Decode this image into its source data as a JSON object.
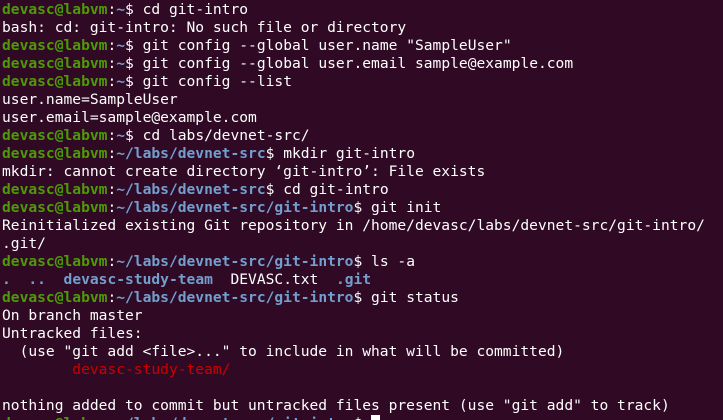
{
  "prompt": {
    "user_host": "devasc@labvm",
    "colon": ":",
    "dollar": "$ "
  },
  "lines": [
    {
      "path": "~",
      "cmd": "cd git-intro"
    },
    {
      "out": "bash: cd: git-intro: No such file or directory"
    },
    {
      "path": "~",
      "cmd": "git config --global user.name \"SampleUser\""
    },
    {
      "path": "~",
      "cmd": "git config --global user.email sample@example.com"
    },
    {
      "path": "~",
      "cmd": "git config --list"
    },
    {
      "out": "user.name=SampleUser"
    },
    {
      "out": "user.email=sample@example.com"
    },
    {
      "path": "~",
      "cmd": "cd labs/devnet-src/"
    },
    {
      "path": "~/labs/devnet-src",
      "cmd": "mkdir git-intro"
    },
    {
      "out": "mkdir: cannot create directory ‘git-intro’: File exists"
    },
    {
      "path": "~/labs/devnet-src",
      "cmd": "cd git-intro"
    },
    {
      "path": "~/labs/devnet-src/git-intro",
      "cmd": "git init"
    },
    {
      "out": "Reinitialized existing Git repository in /home/devasc/labs/devnet-src/git-intro/"
    },
    {
      "out": ".git/"
    },
    {
      "path": "~/labs/devnet-src/git-intro",
      "cmd": "ls -a"
    },
    {
      "ls": [
        {
          "name": ".",
          "type": "dir"
        },
        {
          "name": "..",
          "type": "dir"
        },
        {
          "name": "devasc-study-team",
          "type": "dir"
        },
        {
          "name": "DEVASC.txt",
          "type": "file"
        },
        {
          "name": ".git",
          "type": "dir"
        }
      ]
    },
    {
      "path": "~/labs/devnet-src/git-intro",
      "cmd": "git status"
    },
    {
      "out": "On branch master"
    },
    {
      "out": "Untracked files:"
    },
    {
      "out": "  (use \"git add <file>...\" to include in what will be committed)"
    },
    {
      "untracked": "devasc-study-team/"
    },
    {
      "out": ""
    },
    {
      "out": "nothing added to commit but untracked files present (use \"git add\" to track)"
    },
    {
      "path": "~/labs/devnet-src/git-intro",
      "cmd": "",
      "cursor": true
    }
  ],
  "colors": {
    "background": "#300a24",
    "user": "#4e9a06",
    "path": "#729fcf",
    "text": "#ffffff",
    "untracked": "#cc0000"
  }
}
